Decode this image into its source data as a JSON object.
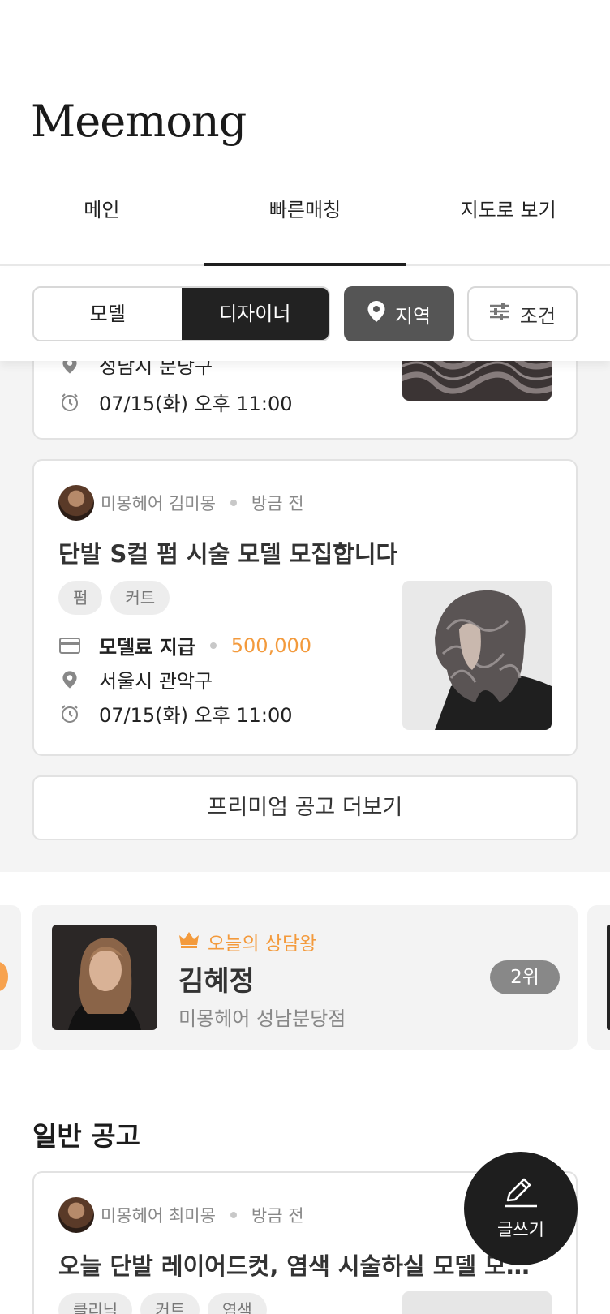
{
  "app": {
    "logo": "Meemong"
  },
  "tabs": [
    {
      "label": "메인",
      "active": false
    },
    {
      "label": "빠른매칭",
      "active": true
    },
    {
      "label": "지도로 보기",
      "active": false
    }
  ],
  "filters": {
    "segment": [
      {
        "label": "모델",
        "selected": false
      },
      {
        "label": "디자이너",
        "selected": true
      }
    ],
    "region_label": "지역",
    "condition_label": "조건"
  },
  "premium_cards": [
    {
      "location": "성남시 분당구",
      "datetime": "07/15(화) 오후 11:00"
    },
    {
      "poster": "미몽헤어 김미몽",
      "time_ago": "방금 전",
      "title": "단발 S컬 펌 시술 모델 모집합니다",
      "tags": [
        "펌",
        "커트"
      ],
      "fee_label": "모델료 지급",
      "fee_value": "500,000",
      "location": "서울시 관악구",
      "datetime": "07/15(화) 오후 11:00"
    }
  ],
  "premium_more_label": "프리미엄 공고 더보기",
  "counselor": {
    "badge": "오늘의 상담왕",
    "name": "김혜정",
    "shop": "미몽헤어 성남분당점",
    "rank": "2위"
  },
  "general": {
    "section_title": "일반 공고",
    "cards": [
      {
        "poster": "미몽헤어 최미몽",
        "time_ago": "방금 전",
        "title": "오늘 단발 레이어드컷, 염색 시술하실 모델 모집합니다",
        "tags": [
          "클리닉",
          "커트",
          "염색"
        ]
      }
    ]
  },
  "fab": {
    "label": "글쓰기"
  },
  "colors": {
    "accent": "#f39a3c",
    "dark": "#1e1e1e"
  }
}
